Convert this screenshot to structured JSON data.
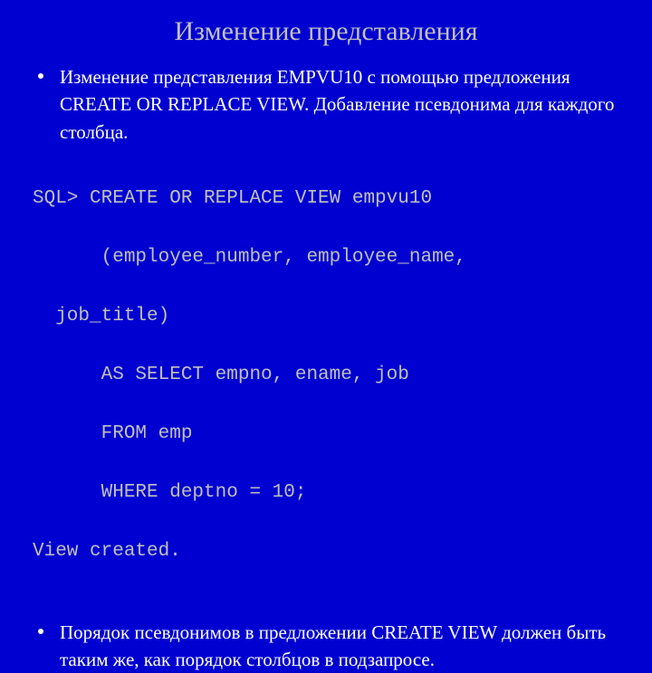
{
  "title": "Изменение представления",
  "bullets": {
    "first": "Изменение представления EMPVU10 с помощью предложения CREATE OR REPLACE VIEW. Добавление псевдонима для каждого столбца.",
    "second": "Порядок псевдонимов в предложении CREATE VIEW должен быть таким же, как порядок столбцов в подзапросе."
  },
  "code": {
    "l1": "SQL> CREATE OR REPLACE VIEW empvu10",
    "l2": "      (employee_number, employee_name,",
    "l3": "  job_title)",
    "l4": "      AS SELECT empno, ename, job",
    "l5": "      FROM emp",
    "l6": "      WHERE deptno = 10;",
    "l7": "View created."
  }
}
